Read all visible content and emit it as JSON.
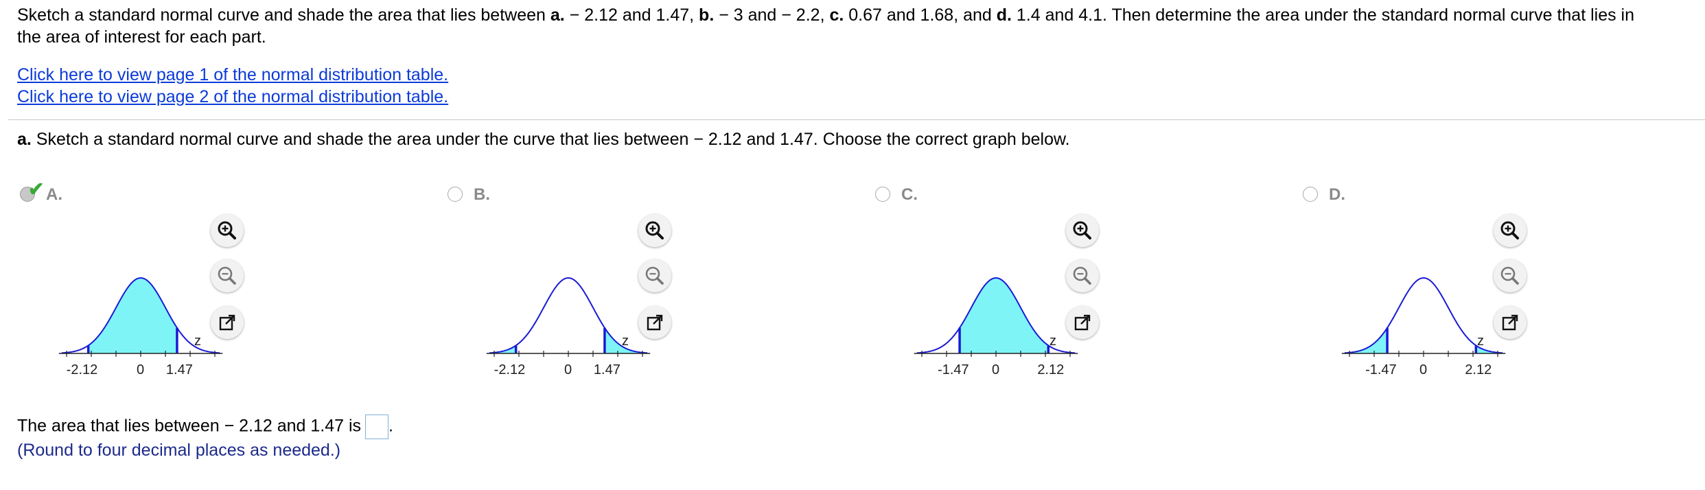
{
  "prompt": {
    "line1_parts": [
      "Sketch a standard normal curve and shade the area that lies between ",
      "a.",
      " − 2.12 and 1.47, ",
      "b.",
      " − 3 and − 2.2, ",
      "c.",
      " 0.67 and 1.68, and ",
      "d.",
      " 1.4 and 4.1. Then determine the area under the standard normal curve that lies in"
    ],
    "line2": "the area of interest for each part."
  },
  "links": {
    "page1": "Click here to view page 1 of the normal distribution table.",
    "page2": "Click here to view page 2 of the normal distribution table."
  },
  "question": {
    "label": "a.",
    "text": " Sketch a standard normal curve and shade the area under the curve that lies between − 2.12 and 1.47. Choose the correct graph below."
  },
  "options": [
    {
      "label": "A.",
      "selected": true,
      "ticks": [
        "-2.12",
        "0",
        "1.47"
      ],
      "axis_label": "z",
      "shade": [
        -2.12,
        1.47
      ],
      "mode": "between"
    },
    {
      "label": "B.",
      "selected": false,
      "ticks": [
        "-2.12",
        "0",
        "1.47"
      ],
      "axis_label": "z",
      "shade": [
        -2.12,
        1.47
      ],
      "mode": "outside"
    },
    {
      "label": "C.",
      "selected": false,
      "ticks": [
        "-1.47",
        "0",
        "2.12"
      ],
      "axis_label": "z",
      "shade": [
        -1.47,
        2.12
      ],
      "mode": "between"
    },
    {
      "label": "D.",
      "selected": false,
      "ticks": [
        "-1.47",
        "0",
        "2.12"
      ],
      "axis_label": "z",
      "shade": [
        -1.47,
        2.12
      ],
      "mode": "outside"
    }
  ],
  "colors": {
    "curve": "#1a1ad6",
    "shade": "#7ef4f6",
    "bound": "#1a1ad6",
    "link": "#0b3bd8",
    "check": "#3aa83a"
  },
  "icons": [
    "zoom-in-icon",
    "zoom-out-icon",
    "pop-out-icon",
    "checkmark-icon"
  ],
  "answer": {
    "text_before": "The area that lies between − 2.12 and 1.47 is",
    "text_after": ".",
    "value": ""
  },
  "hint": "(Round to four decimal places as needed.)"
}
